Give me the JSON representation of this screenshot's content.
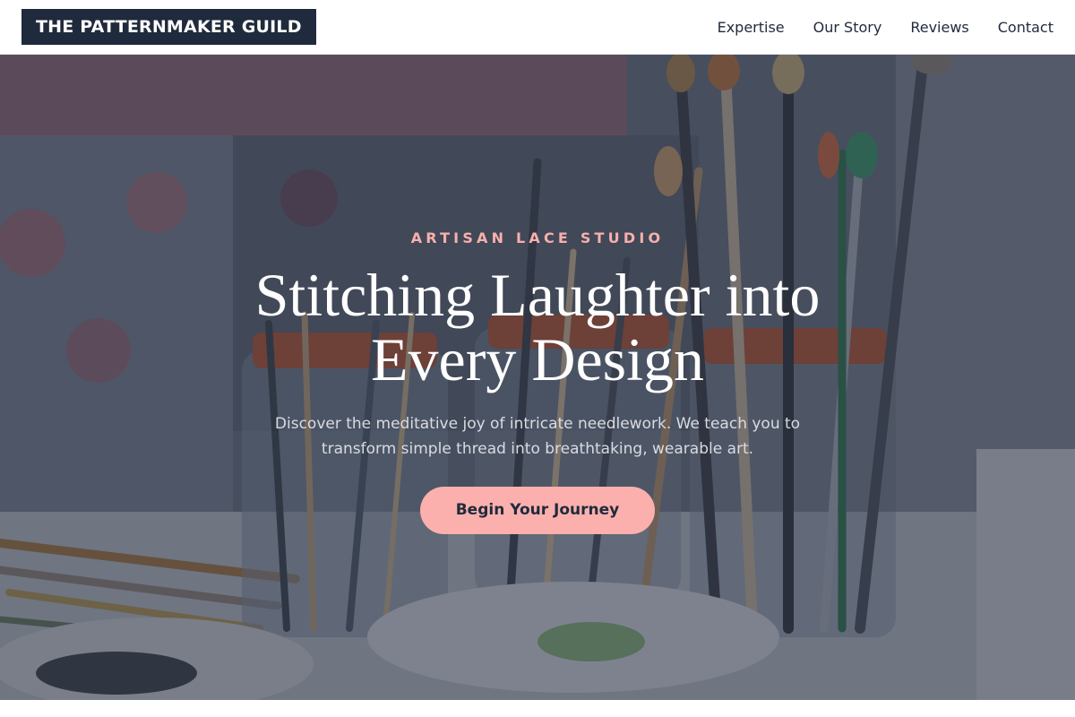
{
  "header": {
    "logo": "THE PATTERNMAKER GUILD",
    "nav": [
      {
        "label": "Expertise"
      },
      {
        "label": "Our Story"
      },
      {
        "label": "Reviews"
      },
      {
        "label": "Contact"
      }
    ]
  },
  "hero": {
    "eyebrow": "ARTISAN LACE STUDIO",
    "title": "Stitching Laughter into Every Design",
    "subtitle": "Discover the meditative joy of intricate needlework. We teach you to transform simple thread into breathtaking, wearable art.",
    "cta": "Begin Your Journey"
  },
  "colors": {
    "brand_dark": "#1f2a3c",
    "accent_pink": "#fbb0ad",
    "eyebrow_pink": "#f7b0ad",
    "overlay": "#283042"
  }
}
